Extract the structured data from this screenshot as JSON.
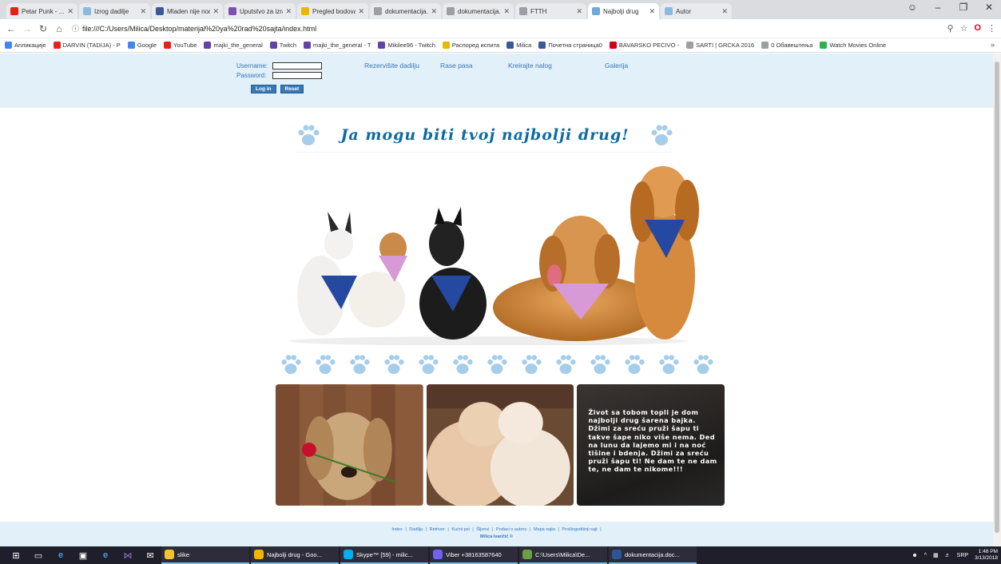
{
  "browser": {
    "tabs": [
      {
        "title": "Petar Punk - ...",
        "color": "#e62117",
        "active": false
      },
      {
        "title": "Izrog dadilje",
        "color": "#8fb8de",
        "active": false
      },
      {
        "title": "Mladen nije nocas",
        "color": "#3b5998",
        "active": false
      },
      {
        "title": "Uputstvo za izradu",
        "color": "#7d4fb3",
        "active": false
      },
      {
        "title": "Pregled bodova | IC",
        "color": "#e6b800",
        "active": false
      },
      {
        "title": "dokumentacija.pdf",
        "color": "#9aa0a6",
        "active": false
      },
      {
        "title": "dokumentacija.pdf",
        "color": "#9aa0a6",
        "active": false
      },
      {
        "title": "FTTH",
        "color": "#9aa0a6",
        "active": false
      },
      {
        "title": "Najbolji drug",
        "color": "#6fa8dc",
        "active": true
      },
      {
        "title": "Autor",
        "color": "#8fb8de",
        "active": false
      }
    ],
    "url": "file:///C:/Users/Milica/Desktop/materijal%20ya%20rad%20sajta/index.html",
    "bookmarks": [
      {
        "label": "Апликације",
        "color": "#4285f4"
      },
      {
        "label": "DARVIN (TADIJA) - P",
        "color": "#e62117"
      },
      {
        "label": "Google",
        "color": "#4285f4"
      },
      {
        "label": "YouTube",
        "color": "#e62117"
      },
      {
        "label": "majki_the_general",
        "color": "#6441a5"
      },
      {
        "label": "Twitch",
        "color": "#6441a5"
      },
      {
        "label": "majki_the_general - T",
        "color": "#6441a5"
      },
      {
        "label": "Mikilee96 - Twitch",
        "color": "#6441a5"
      },
      {
        "label": "Распоред испита",
        "color": "#e6b800"
      },
      {
        "label": "Milica",
        "color": "#3b5998"
      },
      {
        "label": "Почетна страница0",
        "color": "#3b5998"
      },
      {
        "label": "BAVARSKO PECIVO -",
        "color": "#d0021b"
      },
      {
        "label": "SARTI | GRCKA 2016",
        "color": "#9aa0a6"
      },
      {
        "label": "0 Обавештења",
        "color": "#9aa0a6"
      },
      {
        "label": "Watch Movies Online",
        "color": "#2bb24c"
      }
    ],
    "bookmarks_more": "»"
  },
  "site": {
    "login": {
      "username_label": "Username:",
      "password_label": "Password:",
      "login_button": "Log in",
      "reset_button": "Reset"
    },
    "nav": [
      "Rezervišite dadilju",
      "Rase pasa",
      "Kreirajte nalog",
      "Galerija"
    ],
    "hero_title": "Ja mogu biti tvoj najbolji drug!",
    "quote": "Život sa tobom topli je dom najbolji drug šarena bajka. Džimi za sreću pruži šapu ti takve šape niko više nema. Ded na lunu da lajemo mi i na noć tišine i bdenja. Džimi za sreću pruži šapu ti! Ne dam te ne dam te, ne dam te nikome!!!",
    "footer_links": [
      "Index",
      "Dadilja",
      "Retriver",
      "Kućni psi",
      "Šljonvi",
      "Podaci o autoru",
      "Mapa sajta",
      "Prošlogodišnji sajt"
    ],
    "footer_author": "Milica Ivančić ©"
  },
  "taskbar": {
    "apps": [
      {
        "label": "slike",
        "color": "#f4c430"
      },
      {
        "label": "Najbolji drug - Goo...",
        "color": "#f4b400"
      },
      {
        "label": "Skype™ [59] - milic...",
        "color": "#00aff0"
      },
      {
        "label": "Viber +38163587640",
        "color": "#7360f2"
      },
      {
        "label": "C:\\Users\\Milica\\De...",
        "color": "#6a9f45"
      },
      {
        "label": "dokumentacija.doc...",
        "color": "#2b579a"
      }
    ],
    "lang": "SRP",
    "time": "1:48 PM",
    "date": "3/13/2018"
  },
  "colors": {
    "header_bg": "#e2f0f9",
    "link_blue": "#3776b6",
    "title_blue": "#0f6aa1",
    "paw_blue": "#a6cde9"
  }
}
